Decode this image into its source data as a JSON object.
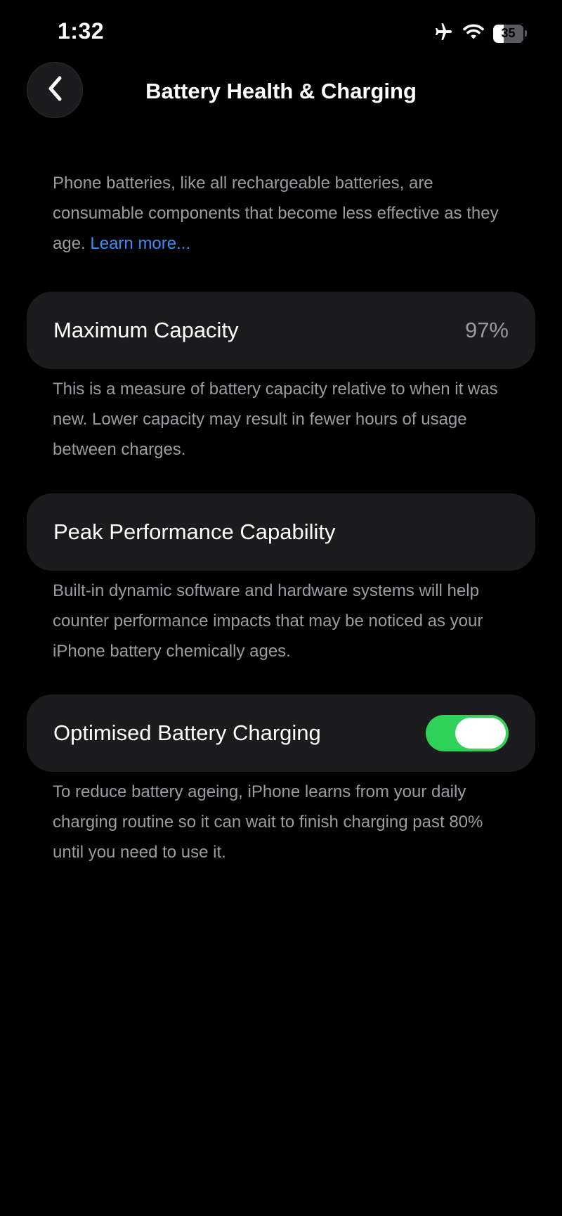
{
  "status_bar": {
    "time": "1:32",
    "battery_level": "35",
    "icons": [
      "airplane-icon",
      "wifi-icon",
      "battery-icon"
    ]
  },
  "nav": {
    "title": "Battery Health & Charging",
    "back_icon": "chevron-left-icon"
  },
  "intro": {
    "text": "Phone batteries, like all rechargeable batteries, are consumable components that become less effective as they age. ",
    "link": "Learn more..."
  },
  "maximum_capacity": {
    "label": "Maximum Capacity",
    "value": "97%",
    "footnote": "This is a measure of battery capacity relative to when it was new. Lower capacity may result in fewer hours of usage between charges."
  },
  "peak_performance": {
    "label": "Peak Performance Capability",
    "footnote": "Built-in dynamic software and hardware systems will help counter performance impacts that may be noticed as your iPhone battery chemically ages."
  },
  "optimised_charging": {
    "label": "Optimised Battery Charging",
    "enabled": true,
    "footnote": "To reduce battery ageing, iPhone learns from your daily charging routine so it can wait to finish charging past 80% until you need to use it."
  },
  "colors": {
    "background": "#000000",
    "card": "#1c1c1e",
    "secondary_text": "#9b9ba1",
    "link": "#3a8ef6",
    "toggle_on": "#30d158"
  }
}
